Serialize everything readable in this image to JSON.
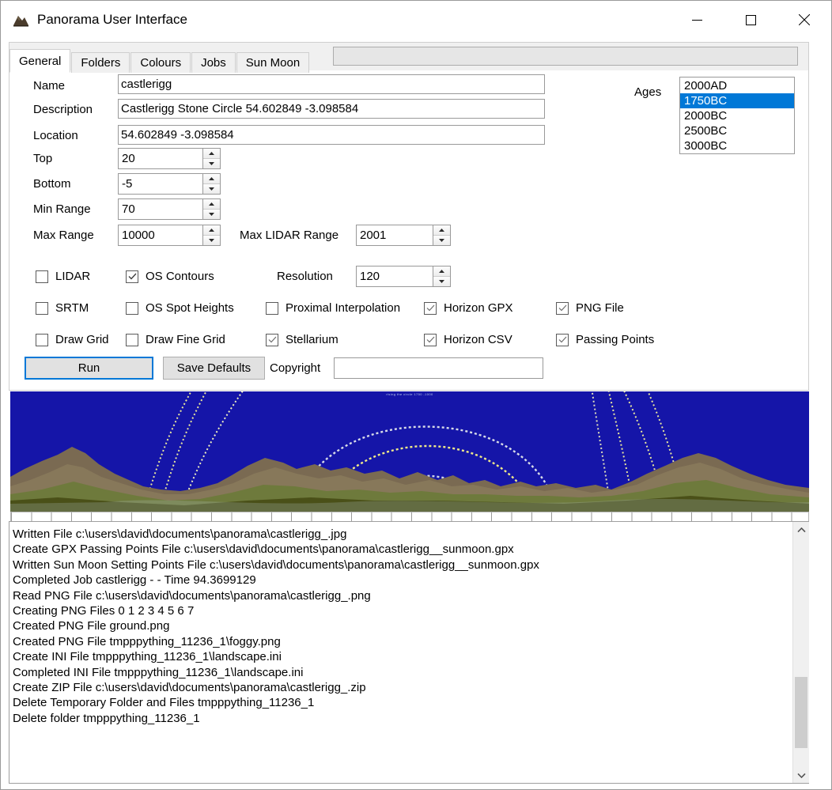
{
  "window": {
    "title": "Panorama User Interface",
    "icon": "mountain-icon",
    "controls": {
      "minimize": "minimize-icon",
      "maximize": "maximize-icon",
      "close": "close-icon"
    }
  },
  "tabs": [
    {
      "label": "General",
      "active": true
    },
    {
      "label": "Folders",
      "active": false
    },
    {
      "label": "Colours",
      "active": false
    },
    {
      "label": "Jobs",
      "active": false
    },
    {
      "label": "Sun Moon",
      "active": false
    }
  ],
  "progress_bar": {
    "value": ""
  },
  "general": {
    "fields": [
      {
        "label": "Name",
        "value": "castlerigg"
      },
      {
        "label": "Description",
        "value": "Castlerigg Stone Circle 54.602849 -3.098584"
      },
      {
        "label": "Location",
        "value": "54.602849 -3.098584"
      }
    ],
    "spinners": [
      {
        "label": "Top",
        "value": "20"
      },
      {
        "label": "Bottom",
        "value": "-5"
      },
      {
        "label": "Min Range",
        "value": "70"
      },
      {
        "label": "Max Range",
        "value": "10000"
      }
    ],
    "max_lidar_range": {
      "label": "Max LIDAR Range",
      "value": "2001"
    },
    "resolution": {
      "label": "Resolution",
      "value": "120"
    },
    "ages": {
      "label": "Ages",
      "items": [
        "2000AD",
        "1750BC",
        "2000BC",
        "2500BC",
        "3000BC"
      ],
      "selected": "1750BC",
      "selected_index": 1
    },
    "checkboxes": [
      {
        "label": "LIDAR",
        "checked": false
      },
      {
        "label": "OS Contours",
        "checked": true
      },
      {
        "label": "SRTM",
        "checked": false
      },
      {
        "label": "OS Spot Heights",
        "checked": false
      },
      {
        "label": "Proximal Interpolation",
        "checked": false
      },
      {
        "label": "Horizon GPX",
        "checked": true
      },
      {
        "label": "PNG File",
        "checked": true
      },
      {
        "label": "Draw Grid",
        "checked": false
      },
      {
        "label": "Draw Fine Grid",
        "checked": false
      },
      {
        "label": "Stellarium",
        "checked": true
      },
      {
        "label": "Horizon CSV",
        "checked": true
      },
      {
        "label": "Passing Points",
        "checked": true
      }
    ],
    "run_button": "Run",
    "save_defaults_button": "Save Defaults",
    "copyright": {
      "label": "Copyright",
      "value": ""
    }
  },
  "panorama": {
    "caption": "rising the circle 1750 -1000",
    "sky_color": "#1515a8",
    "ground_color": "#4a5018",
    "arc_color": "#e8e4a0"
  },
  "log": {
    "lines": [
      "Written File c:\\users\\david\\documents\\panorama\\castlerigg_.jpg",
      "Create GPX Passing Points File c:\\users\\david\\documents\\panorama\\castlerigg__sunmoon.gpx",
      "Written Sun Moon Setting Points File c:\\users\\david\\documents\\panorama\\castlerigg__sunmoon.gpx",
      "Completed Job castlerigg -  -  Time 94.3699129",
      "Read PNG File c:\\users\\david\\documents\\panorama\\castlerigg_.png",
      "Creating PNG Files 0 1 2 3 4 5 6 7",
      "Created PNG File ground.png",
      "Created PNG File tmpppything_11236_1\\foggy.png",
      "Create INI File tmpppything_11236_1\\landscape.ini",
      "Completed INI File tmpppything_11236_1\\landscape.ini",
      "Create ZIP File c:\\users\\david\\documents\\panorama\\castlerigg_.zip",
      "Delete Temporary Folder and Files tmpppything_11236_1",
      "Delete folder tmpppything_11236_1"
    ],
    "scrollbar": {
      "up": "chevron-up-icon",
      "down": "chevron-down-icon"
    }
  }
}
